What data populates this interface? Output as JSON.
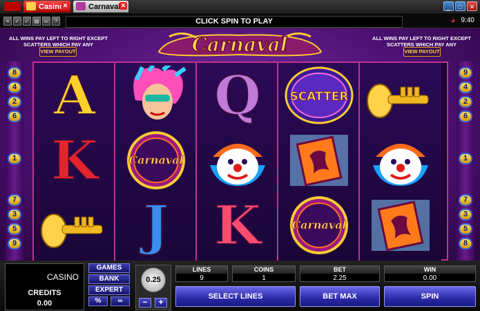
{
  "tabs": [
    {
      "label": "Casino",
      "active": false
    },
    {
      "label": "Carnaval",
      "active": true
    }
  ],
  "toolbar": {
    "message": "CLICK SPIN TO PLAY",
    "clock": "9:40",
    "icons": [
      "options-icon",
      "check-icon",
      "check-icon",
      "stats-icon",
      "phone-icon",
      "help-icon"
    ]
  },
  "game": {
    "logo_text": "Carnaval",
    "info_left": "ALL WINS PAY LEFT TO RIGHT EXCEPT SCATTERS WHICH PAY ANY",
    "info_right": "ALL WINS PAY LEFT TO RIGHT EXCEPT SCATTERS WHICH PAY ANY",
    "view_payout_left": "VIEW PAYOUT",
    "view_payout_right": "VIEW PAYOUT",
    "left_lines": [
      "8",
      "4",
      "2",
      "6",
      "1",
      "7",
      "3",
      "5",
      "9"
    ],
    "right_lines": [
      "9",
      "4",
      "2",
      "6",
      "1",
      "7",
      "3",
      "5",
      "8"
    ],
    "reels": [
      [
        "A",
        "K",
        "trumpet"
      ],
      [
        "showgirl",
        "carnaval-logo",
        "J"
      ],
      [
        "Q",
        "clown",
        "K"
      ],
      [
        "scatter",
        "banner",
        "carnaval-logo"
      ],
      [
        "trumpet",
        "clown",
        "banner"
      ]
    ],
    "symbol_texts": {
      "scatter": "SCATTER",
      "carnaval_logo": "Carnaval"
    }
  },
  "panel": {
    "brand": "CASINO",
    "credits_label": "CREDITS",
    "credits_value": "0.00",
    "menu": [
      "GAMES",
      "BANK",
      "EXPERT"
    ],
    "percent_symbol": "%",
    "coin_value": "0.25",
    "minus": "−",
    "plus": "+",
    "stats": [
      {
        "label": "LINES",
        "value": "9"
      },
      {
        "label": "COINS",
        "value": "1"
      },
      {
        "label": "BET",
        "value": "2.25"
      },
      {
        "label": "WIN",
        "value": "0.00"
      }
    ],
    "buttons": {
      "select_lines": "SELECT LINES",
      "bet_max": "BET MAX",
      "spin": "SPIN"
    }
  },
  "colors": {
    "accent_purple": "#4a1070",
    "reel_border": "#c0328e",
    "button_blue": "#2a2aa8",
    "gold": "#e7a11b"
  }
}
